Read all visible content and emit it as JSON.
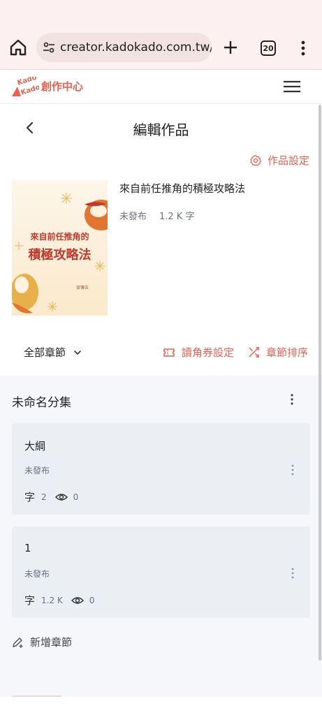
{
  "browser": {
    "url": "creator.kadokado.com.tw/b",
    "tab_count": "20"
  },
  "app": {
    "logo_text": "KadoKado",
    "logo_title": "創作中心"
  },
  "page": {
    "title": "編輯作品",
    "settings_label": "作品設定"
  },
  "book": {
    "title": "來自前任推角的積極攻略法",
    "status": "未發布",
    "word_count": "1.2 K 字",
    "cover_line1": "來自前任推角的",
    "cover_line2": "積極攻略法",
    "cover_author": "宮傳玉"
  },
  "controls": {
    "chapter_filter": "全部章節",
    "ticket_settings": "讀角券設定",
    "chapter_sort": "章節排序"
  },
  "volume": {
    "title": "未命名分集",
    "chapters": [
      {
        "title": "大綱",
        "status": "未發布",
        "zi": "字",
        "words": "2",
        "views": "0"
      },
      {
        "title": "1",
        "status": "未發布",
        "zi": "字",
        "words": "1.2 K",
        "views": "0"
      }
    ],
    "add_chapter": "新增章節"
  },
  "colors": {
    "accent": "#e8624f",
    "browser_bar": "#fcf0f0",
    "panel_bg": "#f5f7fb",
    "card_bg": "#ebeef3"
  }
}
